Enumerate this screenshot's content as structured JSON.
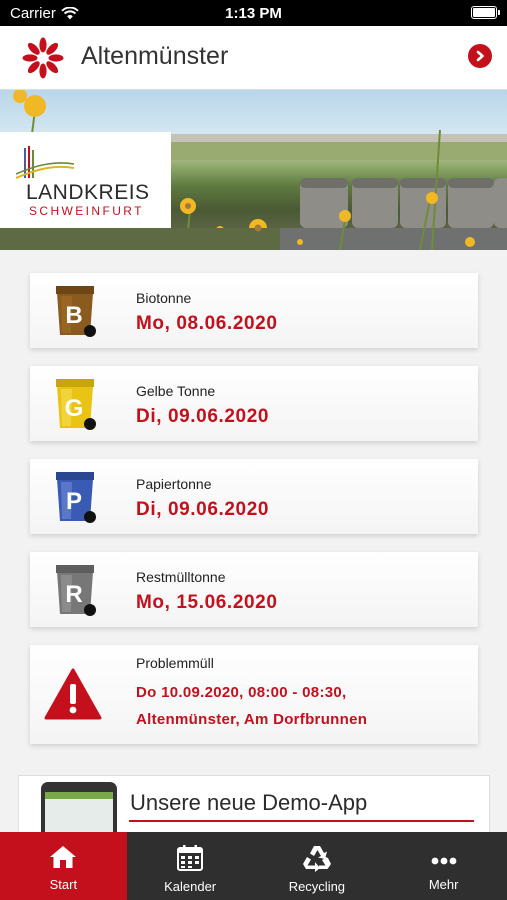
{
  "status_bar": {
    "carrier": "Carrier",
    "time": "1:13 PM"
  },
  "header": {
    "title": "Altenmünster"
  },
  "banner": {
    "logo_title": "LANDKREIS",
    "logo_subtitle": "SCHWEINFURT"
  },
  "bins": [
    {
      "name": "Biotonne",
      "date": "Mo, 08.06.2020",
      "letter": "B",
      "color": "#8a5a1e",
      "icon": "brown-bin-icon"
    },
    {
      "name": "Gelbe Tonne",
      "date": "Di, 09.06.2020",
      "letter": "G",
      "color": "#e9c414",
      "icon": "yellow-bin-icon"
    },
    {
      "name": "Papiertonne",
      "date": "Di, 09.06.2020",
      "letter": "P",
      "color": "#3a5bb4",
      "icon": "blue-bin-icon"
    },
    {
      "name": "Restmülltonne",
      "date": "Mo, 15.06.2020",
      "letter": "R",
      "color": "#777777",
      "icon": "grey-bin-icon"
    }
  ],
  "problem": {
    "name": "Problemmüll",
    "line1": "Do 10.09.2020, 08:00 - 08:30,",
    "line2": "Altenmünster, Am Dorfbrunnen",
    "icon": "warning-icon"
  },
  "promo": {
    "text": "Unsere neue Demo-App"
  },
  "tabs": [
    {
      "label": "Start",
      "icon": "home-icon",
      "active": true
    },
    {
      "label": "Kalender",
      "icon": "calendar-icon",
      "active": false
    },
    {
      "label": "Recycling",
      "icon": "recycling-icon",
      "active": false
    },
    {
      "label": "Mehr",
      "icon": "more-icon",
      "active": false
    }
  ],
  "colors": {
    "accent": "#c4101c",
    "tab_bar": "#2f2f2f"
  }
}
